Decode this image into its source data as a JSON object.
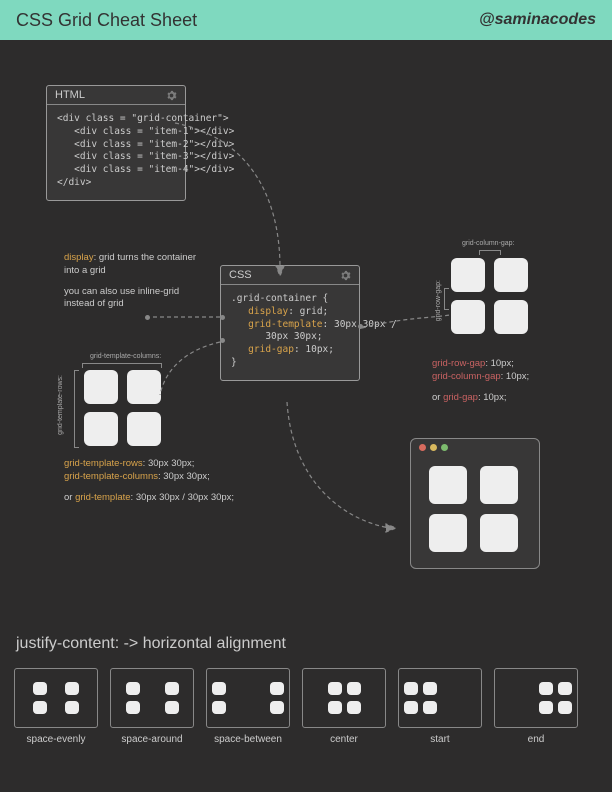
{
  "header": {
    "title": "CSS Grid Cheat Sheet",
    "handle": "@saminacodes"
  },
  "panels": {
    "html": {
      "title": "HTML",
      "code": "<div class = \"grid-container\">\n   <div class = \"item-1\"></div>\n   <div class = \"item-2\"></div>\n   <div class = \"item-3\"></div>\n   <div class = \"item-4\"></div>\n</div>"
    },
    "css": {
      "title": "CSS",
      "lines": {
        "l1": ".grid-container {",
        "k_display": "display",
        "v_display": ": grid;",
        "k_template": "grid-template",
        "v_template_a": ": 30px 30px /",
        "v_template_b": "30px 30px;",
        "k_gap": "grid-gap",
        "v_gap": ": 10px;",
        "lend": "}"
      }
    }
  },
  "notes": {
    "display": {
      "k": "display",
      "t1": ": grid turns the container into a grid",
      "t2": "you can also use inline-grid instead of grid"
    },
    "template": {
      "lbl_rows": "grid-template-rows:",
      "lbl_cols": "grid-template-columns:",
      "k_rows": "grid-template-rows",
      "v_rows": ": 30px 30px;",
      "k_cols": "grid-template-columns",
      "v_cols": ": 30px 30px;",
      "or": "or ",
      "k_template": "grid-template",
      "v_template": ": 30px 30px / 30px 30px;"
    },
    "gap": {
      "lbl_row": "grid-row-gap:",
      "lbl_col": "grid-column-gap:",
      "k_row": "grid-row-gap",
      "v_row": ": 10px;",
      "k_col": "grid-column-gap",
      "v_col": ": 10px;",
      "or": "or ",
      "k_gap": "grid-gap",
      "v_gap": ": 10px;"
    }
  },
  "justify": {
    "title": "justify-content: -> horizontal alignment",
    "variants": [
      "space-evenly",
      "space-around",
      "space-between",
      "center",
      "start",
      "end"
    ]
  }
}
